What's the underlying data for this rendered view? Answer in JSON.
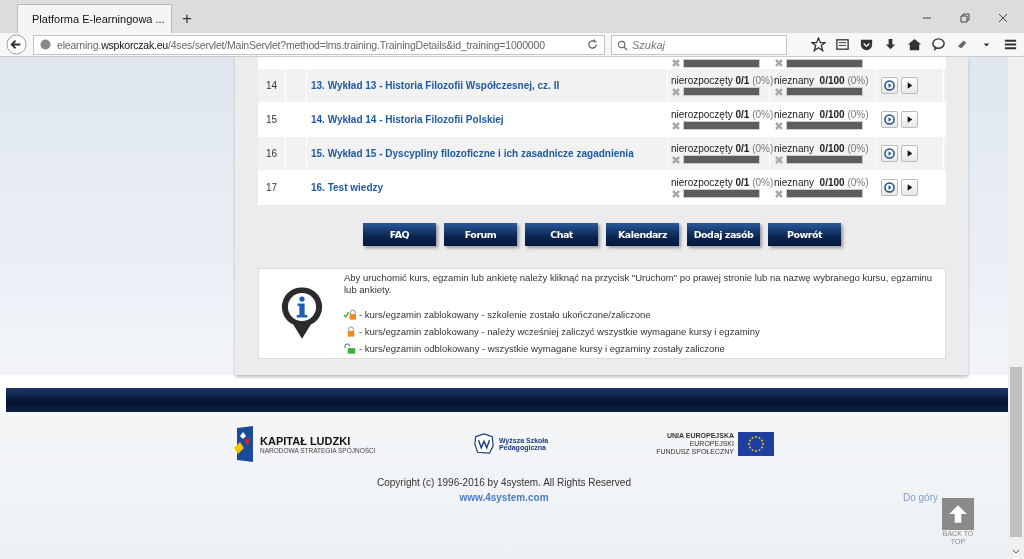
{
  "browser": {
    "tab_title": "Platforma E-learningowa ...",
    "new_tab": "+",
    "url": "elearning.**wspkorczak.eu**/4ses/servlet/MainServlet?method=lms.training.TrainingDetails&id_training=1000000",
    "search_placeholder": "Szukaj"
  },
  "table": {
    "partial_row": {
      "bars": [
        {
          "level": 0
        },
        {
          "level": 0
        }
      ]
    },
    "rows": [
      {
        "number": "14",
        "title": "13. Wykład 13 - Historia Filozofii Współczesnej, cz. II",
        "status": "nierozpoczęty **0/1**",
        "status_percent": "(0%)",
        "status_bar": {
          "level": 0
        },
        "score": "nieznany  **0/100**",
        "score_percent": "(0%)",
        "score_bar": {
          "level": 0
        }
      },
      {
        "number": "15",
        "title": "14. Wykład 14 - Historia Filozofii Polskiej",
        "status": "nierozpoczęty **0/1**",
        "status_percent": "(0%)",
        "status_bar": {
          "level": 0
        },
        "score": "nieznany  **0/100**",
        "score_percent": "(0%)",
        "score_bar": {
          "level": 0
        }
      },
      {
        "number": "16",
        "title": "15. Wykład 15 - Dyscypliny filozoficzne i ich zasadnicze zagadnienia",
        "status": "nierozpoczęty **0/1**",
        "status_percent": "(0%)",
        "status_bar": {
          "level": 0
        },
        "score": "nieznany  **0/100**",
        "score_percent": "(0%)",
        "score_bar": {
          "level": 0
        }
      },
      {
        "number": "17",
        "title": "16. Test wiedzy",
        "status": "nierozpoczęty **0/1**",
        "status_percent": "(0%)",
        "status_bar": {
          "level": 0
        },
        "score": "nieznany  **0/100**",
        "score_percent": "(0%)",
        "score_bar": {
          "level": 0
        }
      }
    ]
  },
  "buttons": [
    "FAQ",
    "Forum",
    "Chat",
    "Kalendarz",
    "Dodaj zasób",
    "Powrót"
  ],
  "info": {
    "text": "Aby uruchomić kurs, egzamin lub ankietę należy kliknąć na przycisk \"Uruchom\" po prawej stronie lub na nazwę wybranego kursu, egzaminu lub ankiety.",
    "legend": [
      {
        "kind": "completed",
        "text": "- kurs/egzamin zablokowany - szkolenie zostało ukończone/zaliczone"
      },
      {
        "kind": "locked",
        "text": "- kurs/egzamin zablokowany - należy wcześniej zaliczyć wszystkie wymagane kursy i egzaminy"
      },
      {
        "kind": "unlocked",
        "text": "- kurs/egzamin odblokowany - wszystkie wymagane kursy i egzaminy zostały zaliczone"
      }
    ]
  },
  "footer": {
    "logo_1": {
      "title": "KAPITAŁ LUDZKI",
      "subtitle": "NARODOWA STRATEGIA SPÓJNOŚCI"
    },
    "logo_2": {
      "title": "Wyższa Szkoła Pedagogiczna"
    },
    "logo_3": {
      "lines": [
        "UNIA EUROPEJSKA",
        "EUROPEJSKI",
        "FUNDUSZ SPOŁECZNY"
      ]
    },
    "copyright": "Copyright (c) 1996-2016 by 4system. All Rights Reserved",
    "link": "www.4system.com",
    "back_label": "Do góry",
    "back_to_top": "BACK TO TOP"
  }
}
